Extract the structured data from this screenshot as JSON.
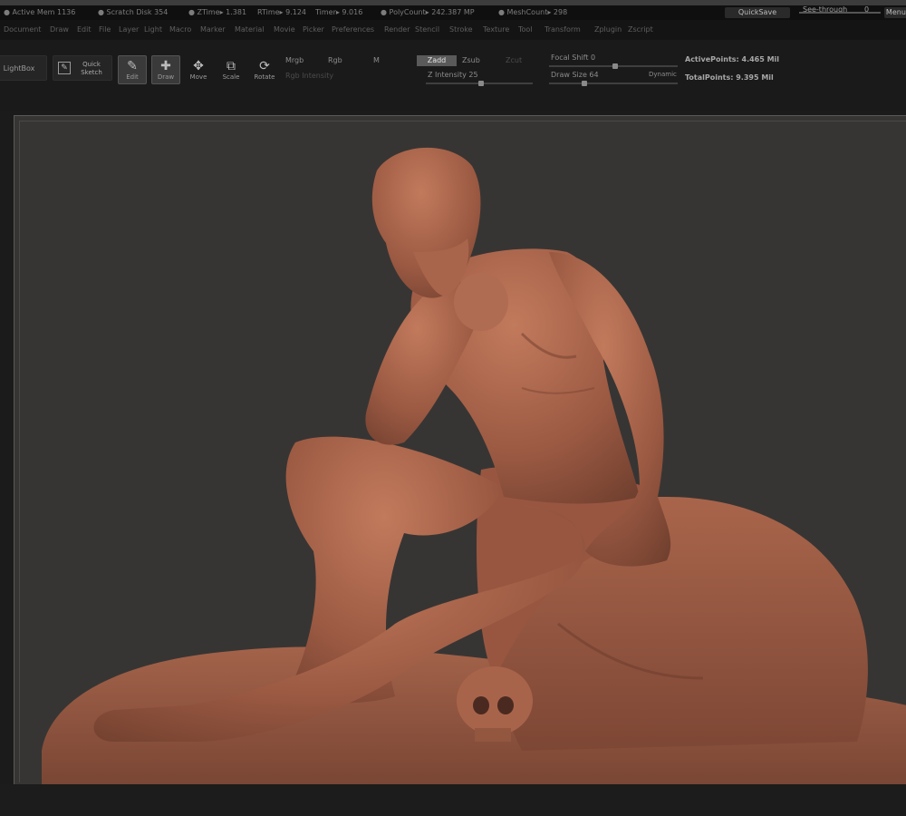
{
  "status": {
    "items": [
      "● Active Mem 1136",
      "● Scratch Disk 354",
      "● ZTime▸ 1.381",
      "RTime▸ 9.124",
      "Timer▸ 9.016",
      "● PolyCount▸ 242.387 MP",
      "● MeshCount▸ 298"
    ],
    "quicksave_label": "QuickSave",
    "seethrough_label": "See-through",
    "seethrough_value": "0",
    "menus_label": "Menus"
  },
  "menus": [
    "Document",
    "Draw",
    "Edit",
    "File",
    "Layer",
    "Light",
    "Macro",
    "Marker",
    "Material",
    "Movie",
    "Picker",
    "Preferences",
    "Render",
    "Stencil",
    "Stroke",
    "Texture",
    "Tool",
    "Transform",
    "Zplugin",
    "Zscript"
  ],
  "toolbar": {
    "lightbox_label": "LightBox",
    "quick_sketch_label": "Quick Sketch",
    "edit_label": "Edit",
    "draw_label": "Draw",
    "move_label": "Move",
    "scale_label": "Scale",
    "rotate_label": "Rotate",
    "mrgb_label": "Mrgb",
    "rgb_label": "Rgb",
    "m_label": "M",
    "rgb_intensity_label": "Rgb Intensity",
    "zadd_label": "Zadd",
    "zsub_label": "Zsub",
    "zcut_label": "Zcut",
    "z_intensity": "Z Intensity 25",
    "focal_shift": "Focal Shift 0",
    "draw_size": "Draw Size 64",
    "dynamic_label": "Dynamic",
    "active_points": "ActivePoints: 4.465 Mil",
    "total_points": "TotalPoints: 9.395 Mil"
  },
  "colors": {
    "clay": "#a8634a",
    "canvas_bg": "#373533",
    "ui_bg": "#1a1a1a"
  }
}
